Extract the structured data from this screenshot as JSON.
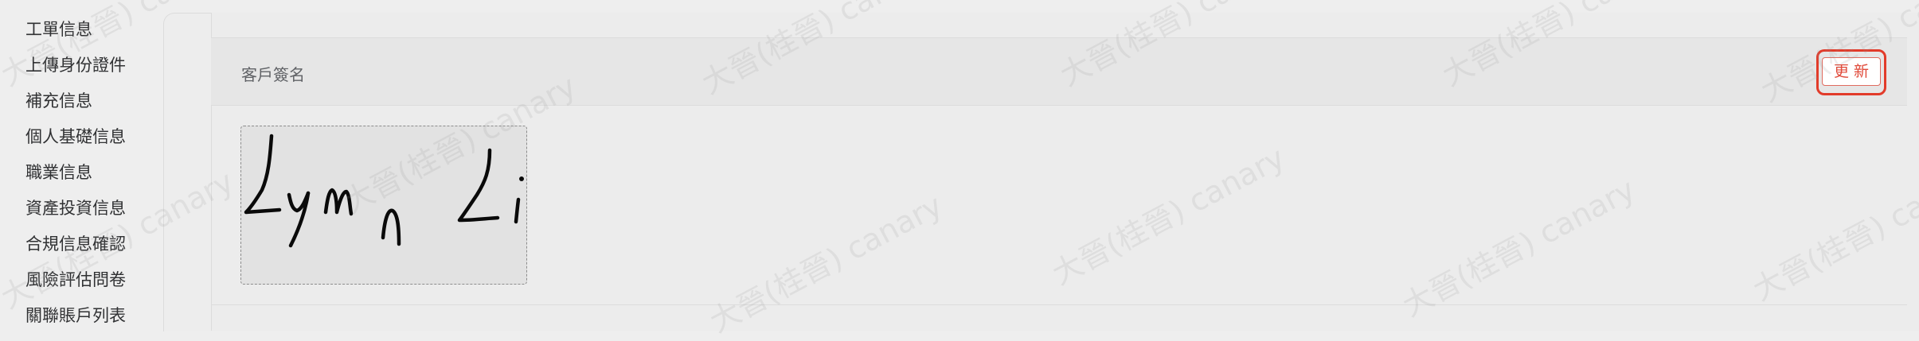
{
  "sidebar": {
    "items": [
      {
        "label": "工單信息"
      },
      {
        "label": "上傳身份證件"
      },
      {
        "label": "補充信息"
      },
      {
        "label": "個人基礎信息"
      },
      {
        "label": "職業信息"
      },
      {
        "label": "資產投資信息"
      },
      {
        "label": "合規信息確認"
      },
      {
        "label": "風險評估問卷"
      },
      {
        "label": "關聯賬戶列表"
      }
    ]
  },
  "section": {
    "title": "客戶簽名",
    "update_label": "更新"
  },
  "signature": {
    "text": "Lynn Li"
  },
  "watermark": {
    "text": "大晉(桂晉) canary"
  }
}
